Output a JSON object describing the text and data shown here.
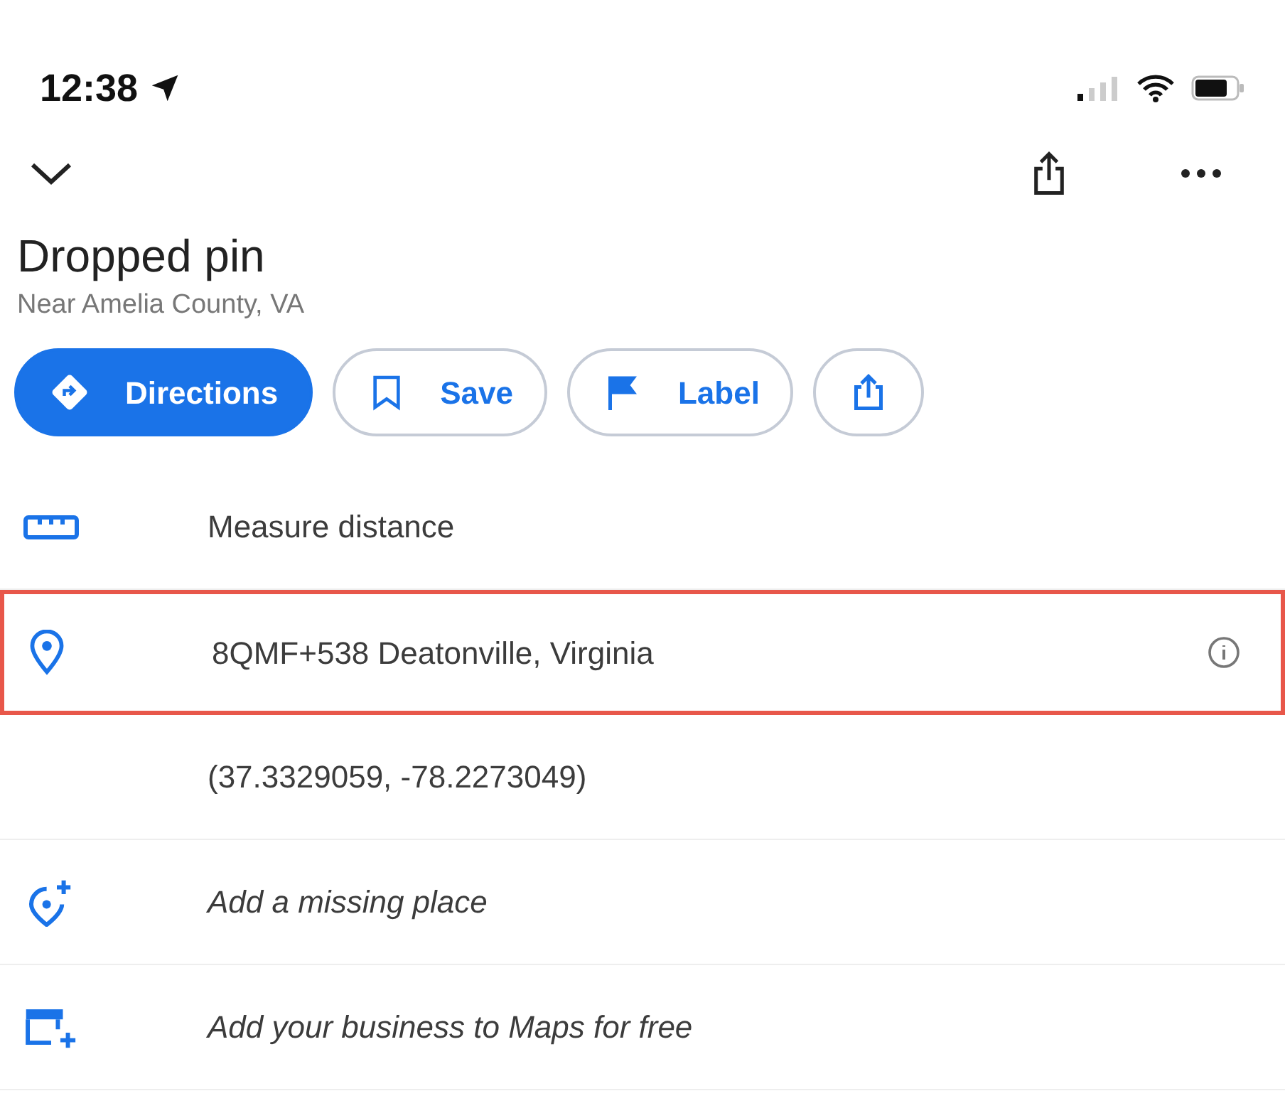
{
  "status_bar": {
    "time": "12:38"
  },
  "place": {
    "title": "Dropped pin",
    "subtitle": "Near Amelia County, VA"
  },
  "actions": [
    {
      "kind": "primary",
      "label": "Directions"
    },
    {
      "kind": "outline",
      "label": "Save"
    },
    {
      "kind": "outline",
      "label": "Label"
    },
    {
      "kind": "outline"
    }
  ],
  "rows": [
    {
      "kind": "measure",
      "text": "Measure distance",
      "highlighted": false
    },
    {
      "kind": "plus-code",
      "text": "8QMF+538 Deatonville, Virginia",
      "highlighted": true
    },
    {
      "kind": "coordinates",
      "text": "(37.3329059, -78.2273049)",
      "highlighted": false
    },
    {
      "kind": "add-place",
      "text": "Add a missing place",
      "highlighted": false
    },
    {
      "kind": "add-business",
      "text": "Add your business to Maps for free",
      "highlighted": false
    }
  ]
}
